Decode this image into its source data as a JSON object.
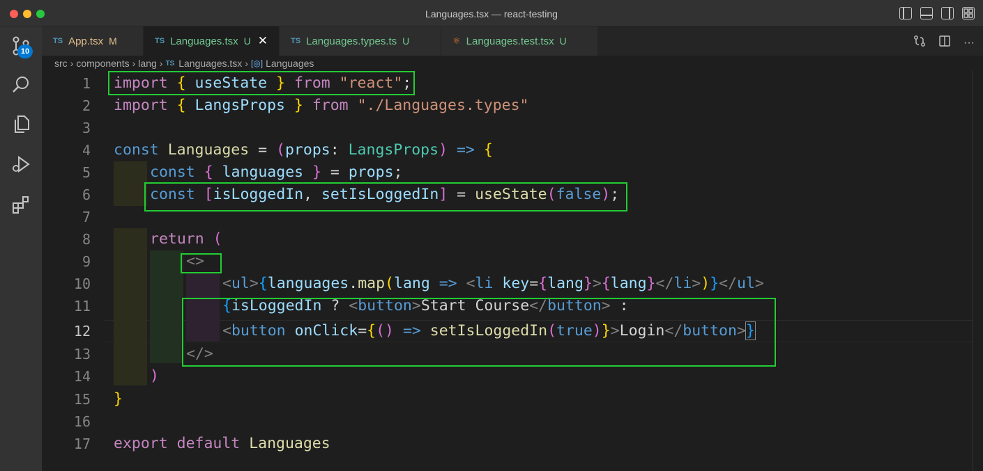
{
  "window": {
    "title": "Languages.tsx — react-testing"
  },
  "activity": {
    "source_control_badge": "10"
  },
  "tabs": [
    {
      "icon": "TS",
      "label": "App.tsx",
      "status": "M"
    },
    {
      "icon": "TS",
      "label": "Languages.tsx",
      "status": "U"
    },
    {
      "icon": "TS",
      "label": "Languages.types.ts",
      "status": "U"
    },
    {
      "icon": "react-icon",
      "label": "Languages.test.tsx",
      "status": "U"
    }
  ],
  "breadcrumb": {
    "parts": [
      "src",
      "components",
      "lang",
      "Languages.tsx",
      "Languages"
    ],
    "file_icon": "TS"
  },
  "editor": {
    "current_line": 12,
    "line_numbers": [
      "1",
      "2",
      "3",
      "4",
      "5",
      "6",
      "7",
      "8",
      "9",
      "10",
      "11",
      "12",
      "13",
      "14",
      "15",
      "16",
      "17"
    ],
    "code": {
      "l1": {
        "t1": "import",
        "t2": " ",
        "t3": "{",
        "t4": " useState ",
        "t5": "}",
        "t6": " ",
        "t7": "from",
        "t8": " ",
        "t9": "\"react\"",
        "t10": ";"
      },
      "l2": {
        "t1": "import",
        "t2": " ",
        "t3": "{",
        "t4": " LangsProps ",
        "t5": "}",
        "t6": " ",
        "t7": "from",
        "t8": " ",
        "t9": "\"./Languages.types\""
      },
      "l4": {
        "t1": "const",
        "t2": " ",
        "t3": "Languages",
        "t4": " = ",
        "t5": "(",
        "t6": "props",
        "t7": ": ",
        "t8": "LangsProps",
        "t9": ")",
        "t10": " ",
        "t11": "=>",
        "t12": " ",
        "t13": "{"
      },
      "l5": {
        "t1": "const",
        "t2": " ",
        "t3": "{",
        "t4": " languages ",
        "t5": "}",
        "t6": " = ",
        "t7": "props",
        "t8": ";"
      },
      "l6": {
        "t1": "const",
        "t2": " ",
        "t3": "[",
        "t4": "isLoggedIn",
        "t5": ", ",
        "t6": "setIsLoggedIn",
        "t7": "]",
        "t8": " = ",
        "t9": "useState",
        "t10": "(",
        "t11": "false",
        "t12": ")",
        "t13": ";"
      },
      "l8": {
        "t1": "return",
        "t2": " ",
        "t3": "("
      },
      "l9": {
        "t1": "<>"
      },
      "l10": {
        "t1": "<",
        "t2": "ul",
        "t3": ">",
        "t4": "{",
        "t5": "languages",
        "t6": ".",
        "t7": "map",
        "t8": "(",
        "t9": "lang",
        "t10": " ",
        "t11": "=>",
        "t12": " ",
        "t13": "<",
        "t14": "li",
        "t15": " ",
        "t16": "key",
        "t17": "=",
        "t18": "{",
        "t19": "lang",
        "t20": "}",
        "t21": ">",
        "t22": "{",
        "t23": "lang",
        "t24": "}",
        "t25": "</",
        "t26": "li",
        "t27": ">",
        "t28": ")",
        "t29": "}",
        "t30": "</",
        "t31": "ul",
        "t32": ">"
      },
      "l11": {
        "t1": "{",
        "t2": "isLoggedIn",
        "t3": " ? ",
        "t4": "<",
        "t5": "button",
        "t6": ">",
        "t7": "Start Course",
        "t8": "</",
        "t9": "button",
        "t10": ">",
        "t11": " :"
      },
      "l12": {
        "t1": "<",
        "t2": "button",
        "t3": " ",
        "t4": "onClick",
        "t5": "=",
        "t6": "{",
        "t7": "()",
        "t8": " ",
        "t9": "=>",
        "t10": " ",
        "t11": "setIsLoggedIn",
        "t12": "(",
        "t13": "true",
        "t14": ")",
        "t15": "}",
        "t16": ">",
        "t17": "Login",
        "t18": "</",
        "t19": "button",
        "t20": ">",
        "t21": "}"
      },
      "l13": {
        "t1": "</>"
      },
      "l14": {
        "t1": ")"
      },
      "l15": {
        "t1": "}"
      },
      "l17": {
        "t1": "export",
        "t2": " ",
        "t3": "default",
        "t4": " ",
        "t5": "Languages"
      }
    }
  },
  "colors": {
    "highlight_box": "#22cc33",
    "accent_badge": "#0078d4"
  }
}
